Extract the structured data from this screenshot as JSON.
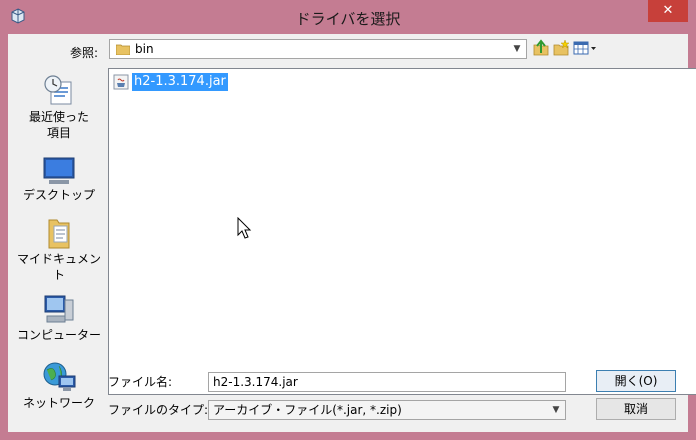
{
  "window": {
    "title": "ドライバを選択",
    "close_glyph": "✕"
  },
  "lookin": {
    "label": "参照:",
    "value": "bin"
  },
  "places": [
    {
      "label_line1": "最近使った",
      "label_line2": "項目",
      "icon": "recent-items-icon"
    },
    {
      "label_line1": "デスクトップ",
      "label_line2": "",
      "icon": "desktop-icon"
    },
    {
      "label_line1": "マイドキュメン",
      "label_line2": "ト",
      "icon": "documents-icon"
    },
    {
      "label_line1": "コンピューター",
      "label_line2": "",
      "icon": "computer-icon"
    },
    {
      "label_line1": "ネットワーク",
      "label_line2": "",
      "icon": "network-icon"
    }
  ],
  "files": [
    {
      "name": "h2-1.3.174.jar",
      "selected": true
    }
  ],
  "filename": {
    "label": "ファイル名:",
    "value": "h2-1.3.174.jar"
  },
  "filetype": {
    "label": "ファイルのタイプ:",
    "value": "アーカイブ・ファイル(*.jar, *.zip)"
  },
  "buttons": {
    "open": "開く(O)",
    "cancel": "取消"
  },
  "colors": {
    "titlebar": "#c47c92",
    "close": "#c7403a",
    "selection": "#3399ff"
  }
}
